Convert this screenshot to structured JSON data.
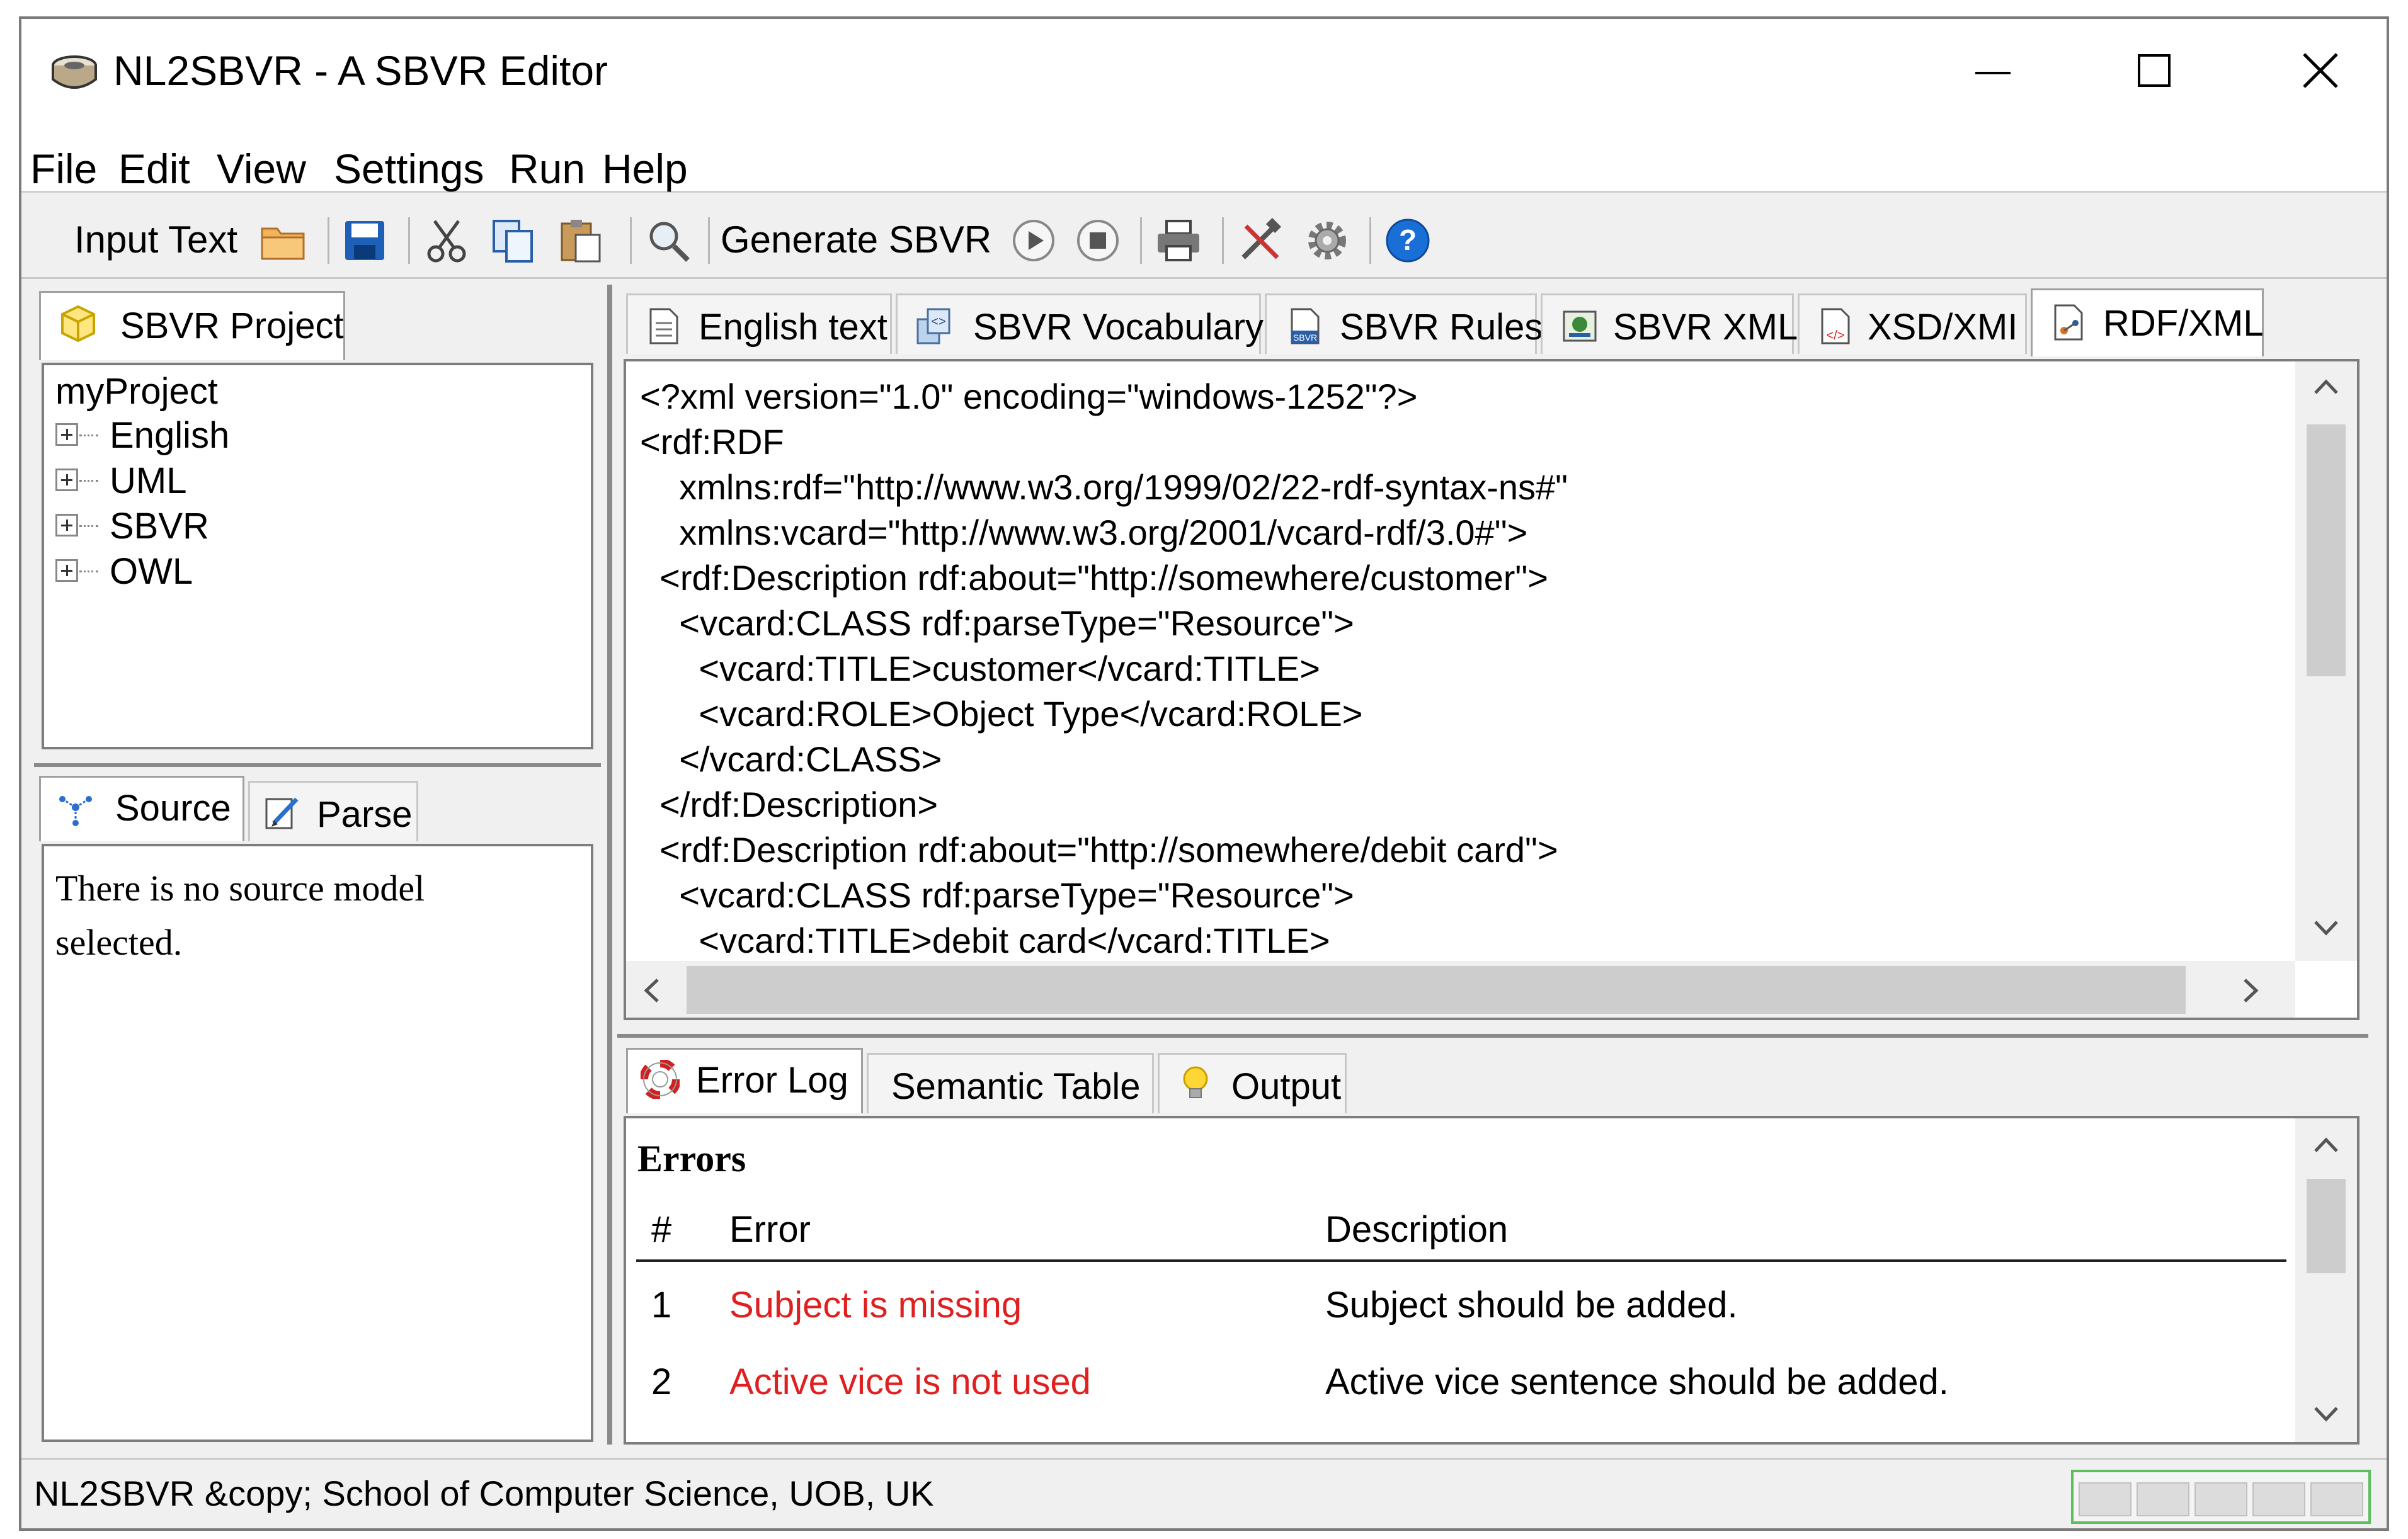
{
  "window": {
    "title": "NL2SBVR - A SBVR Editor",
    "controls": {
      "minimize": "–",
      "maximize": "☐",
      "close": "✕"
    }
  },
  "menu": [
    "File",
    "Edit",
    "View",
    "Settings",
    "Run",
    "Help"
  ],
  "toolbar": {
    "input_text_label": "Input Text",
    "generate_label": "Generate SBVR",
    "icons": [
      "folder-open-icon",
      "save-icon",
      "cut-icon",
      "copy-icon",
      "paste-icon",
      "search-icon",
      "play-icon",
      "stop-icon",
      "print-icon",
      "tools-icon",
      "gear-icon",
      "help-icon"
    ]
  },
  "project_panel": {
    "tab_label": "SBVR Project",
    "root": "myProject",
    "items": [
      "English",
      "UML",
      "SBVR",
      "OWL"
    ]
  },
  "source_panel": {
    "tabs": [
      "Source",
      "Parse"
    ],
    "message": "There is no source model selected."
  },
  "editor": {
    "tabs": [
      "English text",
      "SBVR Vocabulary",
      "SBVR Rules",
      "SBVR XML",
      "XSD/XMI",
      "RDF/XML"
    ],
    "active_tab": "RDF/XML",
    "lines": [
      "<?xml version=\"1.0\" encoding=\"windows-1252\"?>",
      "<rdf:RDF",
      "    xmlns:rdf=\"http://www.w3.org/1999/02/22-rdf-syntax-ns#\"",
      "    xmlns:vcard=\"http://www.w3.org/2001/vcard-rdf/3.0#\">",
      "  <rdf:Description rdf:about=\"http://somewhere/customer\">",
      "    <vcard:CLASS rdf:parseType=\"Resource\">",
      "      <vcard:TITLE>customer</vcard:TITLE>",
      "      <vcard:ROLE>Object Type</vcard:ROLE>",
      "    </vcard:CLASS>",
      "  </rdf:Description>",
      "  <rdf:Description rdf:about=\"http://somewhere/debit card\">",
      "    <vcard:CLASS rdf:parseType=\"Resource\">",
      "      <vcard:TITLE>debit card</vcard:TITLE>"
    ]
  },
  "bottom_panel": {
    "tabs": [
      "Error Log",
      "Semantic Table",
      "Output"
    ],
    "heading": "Errors",
    "columns": [
      "#",
      "Error",
      "Description"
    ],
    "rows": [
      {
        "num": "1",
        "error": "Subject is missing",
        "description": "Subject should be added."
      },
      {
        "num": "2",
        "error": "Active vice is not used",
        "description": "Active vice sentence should be added."
      }
    ]
  },
  "status_bar": {
    "text": "NL2SBVR &copy; School of Computer Science, UOB, UK"
  },
  "colors": {
    "error_text": "#e02020",
    "help_blue": "#1a6fd6",
    "status_progress_border": "#5bbf5b"
  }
}
